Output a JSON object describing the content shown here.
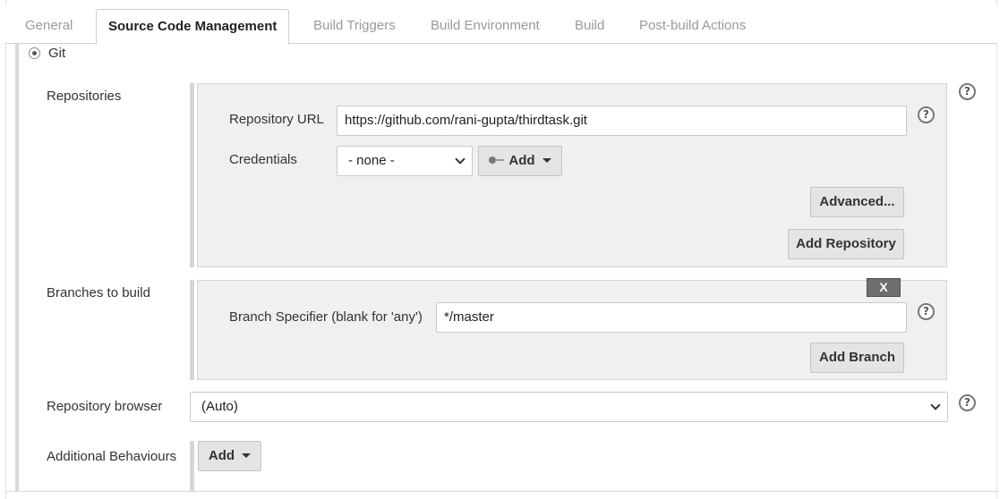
{
  "tabs": [
    {
      "label": "General",
      "active": false
    },
    {
      "label": "Source Code Management",
      "active": true
    },
    {
      "label": "Build Triggers",
      "active": false
    },
    {
      "label": "Build Environment",
      "active": false
    },
    {
      "label": "Build",
      "active": false
    },
    {
      "label": "Post-build Actions",
      "active": false
    }
  ],
  "scm": {
    "git_label": "Git",
    "git_selected": true
  },
  "repositories": {
    "label": "Repositories",
    "url_label": "Repository URL",
    "url_value": "https://github.com/rani-gupta/thirdtask.git",
    "credentials_label": "Credentials",
    "credentials_value": "- none -",
    "add_label": "Add",
    "advanced_label": "Advanced...",
    "add_repository_label": "Add Repository"
  },
  "branches": {
    "label": "Branches to build",
    "delete_label": "X",
    "specifier_label": "Branch Specifier (blank for 'any')",
    "specifier_value": "*/master",
    "add_branch_label": "Add Branch"
  },
  "repository_browser": {
    "label": "Repository browser",
    "value": "(Auto)"
  },
  "additional_behaviours": {
    "label": "Additional Behaviours",
    "add_label": "Add"
  },
  "help_glyph": "?",
  "colors": {
    "button_bg": "#e4e4e4",
    "box_bg": "#f0f0f0",
    "delete_bg": "#6e6e6e"
  }
}
